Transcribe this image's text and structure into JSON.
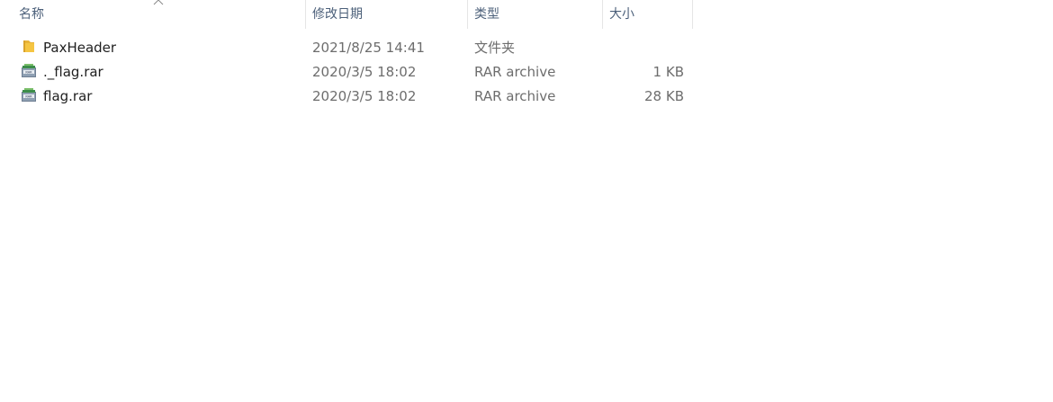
{
  "columns": {
    "name": "名称",
    "date": "修改日期",
    "type": "类型",
    "size": "大小"
  },
  "sort": {
    "column": "name",
    "direction": "ascending",
    "icon": "chevron-up-icon"
  },
  "files": [
    {
      "name": "PaxHeader",
      "date": "2021/8/25 14:41",
      "type": "文件夹",
      "size": "",
      "icon": "folder-icon"
    },
    {
      "name": "._flag.rar",
      "date": "2020/3/5 18:02",
      "type": "RAR archive",
      "size": "1 KB",
      "icon": "rar-archive-icon"
    },
    {
      "name": "flag.rar",
      "date": "2020/3/5 18:02",
      "type": "RAR archive",
      "size": "28 KB",
      "icon": "rar-archive-icon"
    }
  ],
  "colors": {
    "header_text": "#4c607a",
    "folder": "#f5c542",
    "secondary_text": "#6d6d6d"
  }
}
